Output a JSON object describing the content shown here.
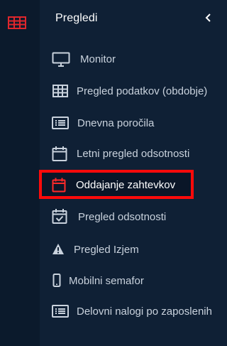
{
  "header": {
    "title": "Pregledi",
    "collapse_icon": "chevron-left-icon"
  },
  "rail": {
    "icon": "table-grid-icon",
    "accent": "#e0262c"
  },
  "menu": [
    {
      "label": "Monitor",
      "icon": "monitor-icon"
    },
    {
      "label": "Pregled podatkov (obdobje)",
      "icon": "table-icon"
    },
    {
      "label": "Dnevna poročila",
      "icon": "list-icon"
    },
    {
      "label": "Letni pregled odsotnosti",
      "icon": "calendar-icon"
    },
    {
      "label": "Oddajanje zahtevkov",
      "icon": "calendar-icon",
      "active": true
    },
    {
      "label": "Pregled odsotnosti",
      "icon": "calendar-check-icon"
    },
    {
      "label": "Pregled Izjem",
      "icon": "warning-icon"
    },
    {
      "label": "Mobilni semafor",
      "icon": "mobile-icon"
    },
    {
      "label": "Delovni nalogi po zaposlenih",
      "icon": "list-icon"
    }
  ],
  "colors": {
    "background": "#0f2035",
    "text": "#c9d2dd",
    "highlight_border": "#ff0a0a"
  }
}
